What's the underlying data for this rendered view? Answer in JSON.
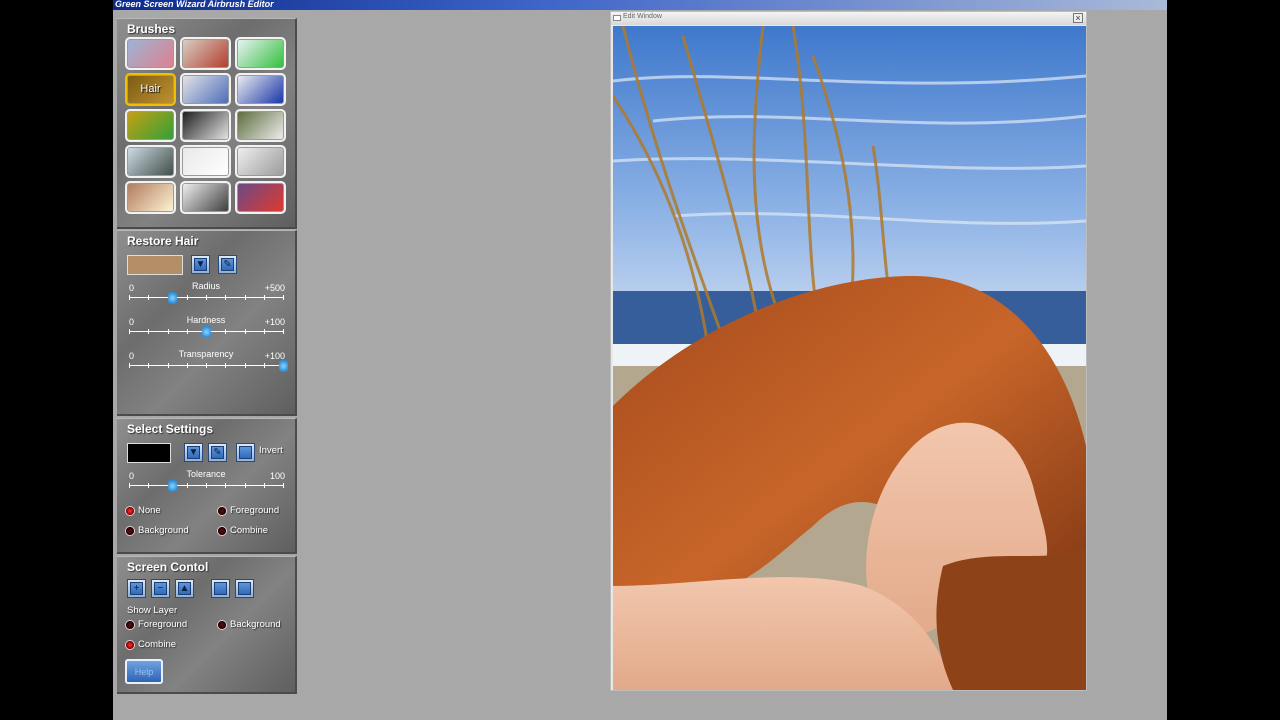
{
  "app": {
    "title": "Green Screen Wizard Airbrush Editor"
  },
  "brushes": {
    "title": "Brushes",
    "hover_label": "Hair",
    "items": [
      {
        "name": "eraser",
        "bg": "#9ab5d8",
        "fg": "#e07f8c"
      },
      {
        "name": "flowers",
        "bg": "#d8d2c8",
        "fg": "#b33b2a"
      },
      {
        "name": "rainbow",
        "bg": "#eef3f8",
        "fg": "#2fbf3a"
      },
      {
        "name": "hair",
        "bg": "#7a5a14",
        "fg": "#c09232"
      },
      {
        "name": "palette",
        "bg": "#e6e6e6",
        "fg": "#4b6bb8"
      },
      {
        "name": "blue-yellow",
        "bg": "#f0f0f0",
        "fg": "#1432a8"
      },
      {
        "name": "green-toy",
        "bg": "#c8a012",
        "fg": "#2fa03a"
      },
      {
        "name": "tuxedo",
        "bg": "#1a1a1a",
        "fg": "#e8e8e8"
      },
      {
        "name": "wedding",
        "bg": "#5a6a3a",
        "fg": "#f0f0f0"
      },
      {
        "name": "palm-tree",
        "bg": "#d0dfe8",
        "fg": "#3e4a45"
      },
      {
        "name": "white-swirl",
        "bg": "#e8e8e8",
        "fg": "#ffffff"
      },
      {
        "name": "machine",
        "bg": "#f0f0f0",
        "fg": "#9a9a9a"
      },
      {
        "name": "light-bulb",
        "bg": "#b07a5a",
        "fg": "#fff6d8"
      },
      {
        "name": "gradient",
        "bg": "#f4f4f4",
        "fg": "#3a3a3a"
      },
      {
        "name": "paint-cans",
        "bg": "#6a4a8a",
        "fg": "#e03a2a"
      }
    ]
  },
  "restore": {
    "title": "Restore Hair",
    "color": "#b38e67",
    "radius": {
      "label": "Radius",
      "min": "0",
      "max": "+500",
      "value": 0.28
    },
    "hardness": {
      "label": "Hardness",
      "min": "0",
      "max": "+100",
      "value": 0.5
    },
    "transparency": {
      "label": "Transparency",
      "min": "0",
      "max": "+100",
      "value": 1.0
    }
  },
  "select": {
    "title": "Select Settings",
    "color": "#000000",
    "invert_label": "Invert",
    "tolerance": {
      "label": "Tolerance",
      "min": "0",
      "max": "100",
      "value": 0.28
    },
    "opt_none": "None",
    "opt_foreground": "Foreground",
    "opt_background": "Background",
    "opt_combine": "Combine"
  },
  "screen": {
    "title": "Screen Contol",
    "show_layer": "Show Layer",
    "opt_foreground": "Foreground",
    "opt_background": "Background",
    "opt_combine": "Combine",
    "help": "Help"
  },
  "editwin": {
    "title": "Edit Window",
    "close": "×"
  },
  "colors": {
    "accent": "#2f6bbd",
    "selected_brush": "#f0c000"
  }
}
